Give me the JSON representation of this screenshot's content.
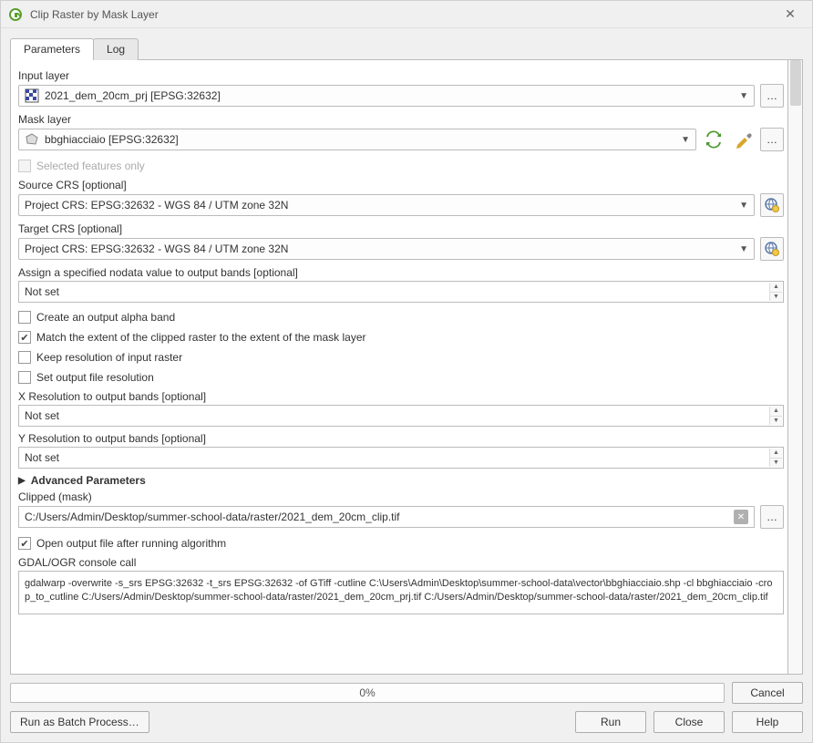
{
  "window": {
    "title": "Clip Raster by Mask Layer"
  },
  "tabs": {
    "parameters": "Parameters",
    "log": "Log"
  },
  "labels": {
    "input_layer": "Input layer",
    "mask_layer": "Mask layer",
    "selected_features_only": "Selected features only",
    "source_crs": "Source CRS [optional]",
    "target_crs": "Target CRS [optional]",
    "nodata": "Assign a specified nodata value to output bands [optional]",
    "alpha": "Create an output alpha band",
    "match_extent": "Match the extent of the clipped raster to the extent of the mask layer",
    "keep_res": "Keep resolution of input raster",
    "set_file_res": "Set output file resolution",
    "x_res": "X Resolution to output bands [optional]",
    "y_res": "Y Resolution to output bands [optional]",
    "advanced": "Advanced Parameters",
    "clipped": "Clipped (mask)",
    "open_output": "Open output file after running algorithm",
    "console_call": "GDAL/OGR console call"
  },
  "values": {
    "input_layer": "2021_dem_20cm_prj [EPSG:32632]",
    "mask_layer": "bbghiacciaio [EPSG:32632]",
    "source_crs": "Project CRS: EPSG:32632 - WGS 84 / UTM zone 32N",
    "target_crs": "Project CRS: EPSG:32632 - WGS 84 / UTM zone 32N",
    "nodata": "Not set",
    "x_res": "Not set",
    "y_res": "Not set",
    "clipped": "C:/Users/Admin/Desktop/summer-school-data/raster/2021_dem_20cm_clip.tif",
    "console": "gdalwarp -overwrite -s_srs EPSG:32632 -t_srs EPSG:32632 -of GTiff -cutline C:\\Users\\Admin\\Desktop\\summer-school-data\\vector\\bbghiacciaio.shp -cl bbghiacciaio -crop_to_cutline C:/Users/Admin/Desktop/summer-school-data/raster/2021_dem_20cm_prj.tif C:/Users/Admin/Desktop/summer-school-data/raster/2021_dem_20cm_clip.tif",
    "progress": "0%"
  },
  "checks": {
    "selected_features_only": false,
    "alpha": false,
    "match_extent": true,
    "keep_res": false,
    "set_file_res": false,
    "open_output": true
  },
  "buttons": {
    "ellipsis": "…",
    "cancel": "Cancel",
    "batch": "Run as Batch Process…",
    "run": "Run",
    "close": "Close",
    "help": "Help"
  }
}
